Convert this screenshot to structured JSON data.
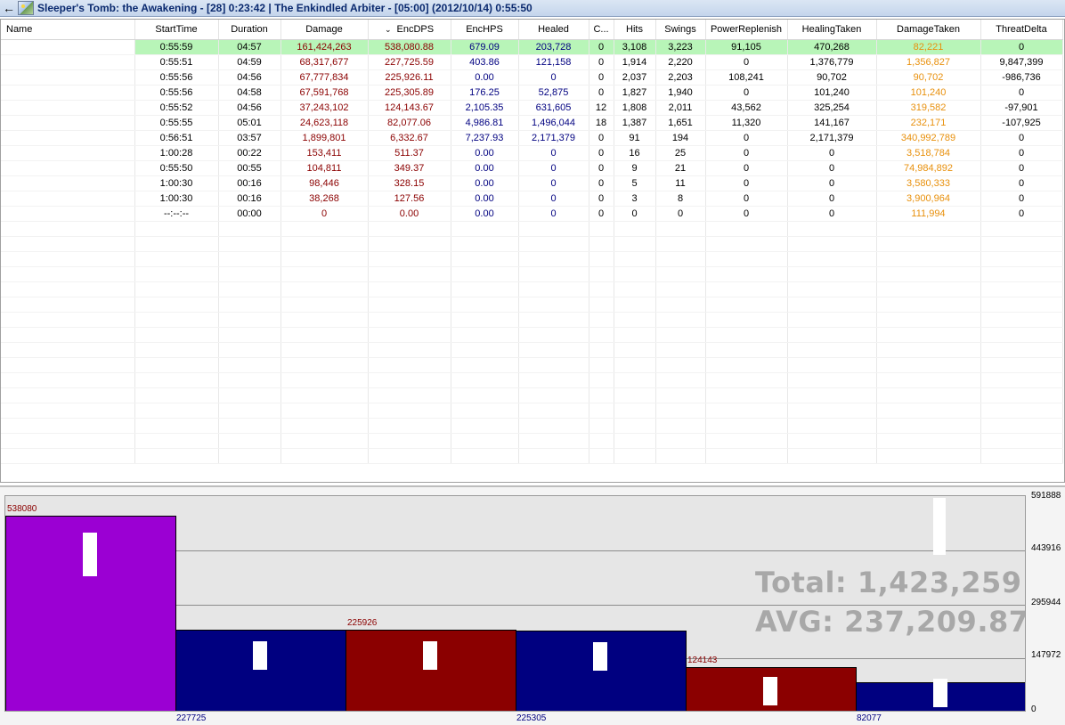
{
  "title_bar": {
    "back_icon": "back-arrow-icon",
    "picture_icon": "picture-icon",
    "title": "Sleeper's Tomb: the Awakening - [28] 0:23:42  |  The Enkindled Arbiter - [05:00] (2012/10/14) 0:55:50"
  },
  "grid": {
    "columns": [
      "Name",
      "StartTime",
      "Duration",
      "Damage",
      "EncDPS",
      "EncHPS",
      "Healed",
      "C...",
      "Hits",
      "Swings",
      "PowerReplenish",
      "HealingTaken",
      "DamageTaken",
      "ThreatDelta"
    ],
    "sort_indicator": "⌄",
    "selected_row": 0,
    "rows": [
      [
        "",
        "0:55:59",
        "04:57",
        "161,424,263",
        "538,080.88",
        "679.09",
        "203,728",
        "0",
        "3,108",
        "3,223",
        "91,105",
        "470,268",
        "82,221",
        "0"
      ],
      [
        "",
        "0:55:51",
        "04:59",
        "68,317,677",
        "227,725.59",
        "403.86",
        "121,158",
        "0",
        "1,914",
        "2,220",
        "0",
        "1,376,779",
        "1,356,827",
        "9,847,399"
      ],
      [
        "",
        "0:55:56",
        "04:56",
        "67,777,834",
        "225,926.11",
        "0.00",
        "0",
        "0",
        "2,037",
        "2,203",
        "108,241",
        "90,702",
        "90,702",
        "-986,736"
      ],
      [
        "",
        "0:55:56",
        "04:58",
        "67,591,768",
        "225,305.89",
        "176.25",
        "52,875",
        "0",
        "1,827",
        "1,940",
        "0",
        "101,240",
        "101,240",
        "0"
      ],
      [
        "",
        "0:55:52",
        "04:56",
        "37,243,102",
        "124,143.67",
        "2,105.35",
        "631,605",
        "12",
        "1,808",
        "2,011",
        "43,562",
        "325,254",
        "319,582",
        "-97,901"
      ],
      [
        "",
        "0:55:55",
        "05:01",
        "24,623,118",
        "82,077.06",
        "4,986.81",
        "1,496,044",
        "18",
        "1,387",
        "1,651",
        "11,320",
        "141,167",
        "232,171",
        "-107,925"
      ],
      [
        "",
        "0:56:51",
        "03:57",
        "1,899,801",
        "6,332.67",
        "7,237.93",
        "2,171,379",
        "0",
        "91",
        "194",
        "0",
        "2,171,379",
        "340,992,789",
        "0"
      ],
      [
        "",
        "1:00:28",
        "00:22",
        "153,411",
        "511.37",
        "0.00",
        "0",
        "0",
        "16",
        "25",
        "0",
        "0",
        "3,518,784",
        "0"
      ],
      [
        "",
        "0:55:50",
        "00:55",
        "104,811",
        "349.37",
        "0.00",
        "0",
        "0",
        "9",
        "21",
        "0",
        "0",
        "74,984,892",
        "0"
      ],
      [
        "",
        "1:00:30",
        "00:16",
        "98,446",
        "328.15",
        "0.00",
        "0",
        "0",
        "5",
        "11",
        "0",
        "0",
        "3,580,333",
        "0"
      ],
      [
        "",
        "1:00:30",
        "00:16",
        "38,268",
        "127.56",
        "0.00",
        "0",
        "0",
        "3",
        "8",
        "0",
        "0",
        "3,900,964",
        "0"
      ],
      [
        "",
        "--:--:--",
        "00:00",
        "0",
        "0.00",
        "0.00",
        "0",
        "0",
        "0",
        "0",
        "0",
        "0",
        "111,994",
        "0"
      ]
    ]
  },
  "chart": {
    "axis_labels": [
      "591888",
      "443916",
      "295944",
      "147972",
      "0"
    ],
    "total_text": "Total: 1,423,259",
    "avg_text": "AVG: 237,209.87",
    "colors": {
      "purple": "#9b00d3",
      "blue": "#000080",
      "red": "#8b0000",
      "marker": "#ffffff"
    }
  },
  "chart_data": {
    "type": "bar",
    "ylim": [
      0,
      591888
    ],
    "ticks": [
      0,
      147972,
      295944,
      443916,
      591888
    ],
    "values": [
      538080,
      227725,
      225926,
      225305,
      124143,
      82077
    ],
    "labels": [
      "538080",
      "227725",
      "225926",
      "225305",
      "124143",
      "82077"
    ],
    "label_positions": [
      "top",
      "bottom",
      "top",
      "bottom",
      "top",
      "bottom"
    ],
    "colors": [
      "#9b00d3",
      "#000080",
      "#8b0000",
      "#000080",
      "#8b0000",
      "#000080"
    ]
  }
}
